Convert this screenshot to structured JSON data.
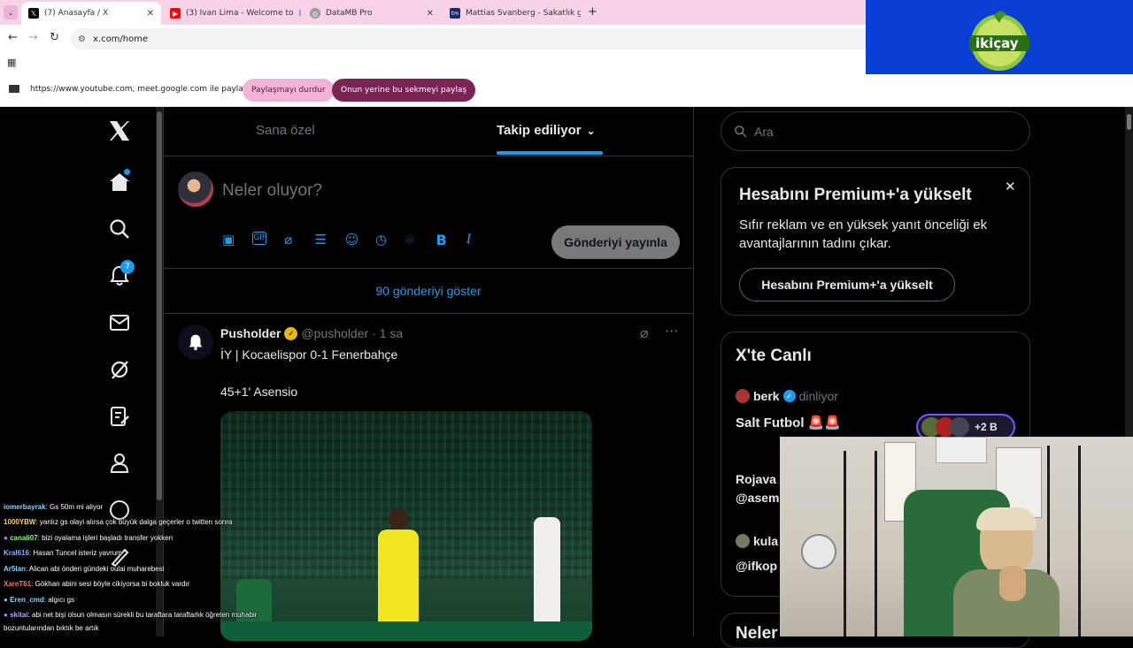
{
  "browser": {
    "tabs": [
      {
        "label": "(7) Anasayfa / X",
        "favicon": "x-icon",
        "active": true
      },
      {
        "label": "(3) Ivan Lima - Welcome to",
        "favicon": "youtube-icon",
        "active": false
      },
      {
        "label": "DataMB Pro",
        "favicon": "globe-icon",
        "active": false
      },
      {
        "label": "Mattias Svanberg - Sakatlık geç",
        "favicon": "tm-icon",
        "active": false
      }
    ],
    "url": "x.com/home",
    "share_message": "https://www.youtube.com, meet.google.com ile paylaşılıyor",
    "stop_sharing": "Paylaşmayı durdur",
    "share_this_tab": "Onun yerine bu sekmeyi paylaş"
  },
  "overlay_logo": {
    "text": "ikiçay",
    "bg_color": "#0a3fd6"
  },
  "nav": {
    "notifications_badge": "7"
  },
  "feed": {
    "tabs": [
      {
        "label": "Sana özel",
        "active": false
      },
      {
        "label": "Takip ediliyor",
        "active": true
      }
    ],
    "compose_placeholder": "Neler oluyor?",
    "post_button": "Gönderiyi yayınla",
    "show_posts": "90 gönderiyi göster",
    "post": {
      "author": "Pusholder",
      "handle": "@pusholder",
      "time": "· 1 sa",
      "line1": "İY | Kocaelispor 0-1 Fenerbahçe",
      "line2": "45+1' Asensio"
    }
  },
  "sidebar": {
    "search_placeholder": "Ara",
    "premium": {
      "title": "Hesabını Premium+'a yükselt",
      "body": "Sıfır reklam ve en yüksek yanıt önceliği ek avantajlarının tadını çıkar.",
      "button": "Hesabını Premium+'a yükselt"
    },
    "live": {
      "title": "X'te Canlı",
      "items": [
        {
          "user": "berk",
          "status": "dinliyor",
          "space": "Salt Futbol 🚨🚨",
          "listeners": "+2 B"
        },
        {
          "user": "Rojava",
          "handle": "@asem"
        },
        {
          "user": "kula",
          "handle": "@ifkop"
        }
      ]
    },
    "next_title": "Neler"
  },
  "chat": [
    {
      "user": "iomerbayrak",
      "color": "#7fd7ff",
      "msg": ": Gs 50m mi aliyor"
    },
    {
      "user": "1000YBW",
      "color": "#ffd54a",
      "msg": ": yanlız gs olayi alırsa çok büyük dalga geçerler o twitten sonra"
    },
    {
      "user": "canali07",
      "color": "#8cff6a",
      "msg": ": bizi oyalama işleri başladı transfer yokken"
    },
    {
      "user": "Kral616",
      "color": "#7fb6ff",
      "msg": ": Hasan Tuncel isteriz yavrum"
    },
    {
      "user": "Ar5lan",
      "color": "#7fd7ff",
      "msg": ": Alican abi önderi gündeki oulai muharebesi"
    },
    {
      "user": "XareT61",
      "color": "#ff6b6b",
      "msg": ": Gökhan abini sesi böyle cikiyorsa bi bokluk vardır"
    },
    {
      "user": "Eren_cmd",
      "color": "#7fd7ff",
      "msg": ": algıcı gs"
    },
    {
      "user": "skitai",
      "color": "#b8a4ff",
      "msg": ": abi net bişi olsun olmasın sürekli bu taraftara taraftarlık öğreten muhabir"
    },
    {
      "user": "",
      "color": "#ffffff",
      "msg": "bozuntularından bıktık be artık"
    }
  ]
}
